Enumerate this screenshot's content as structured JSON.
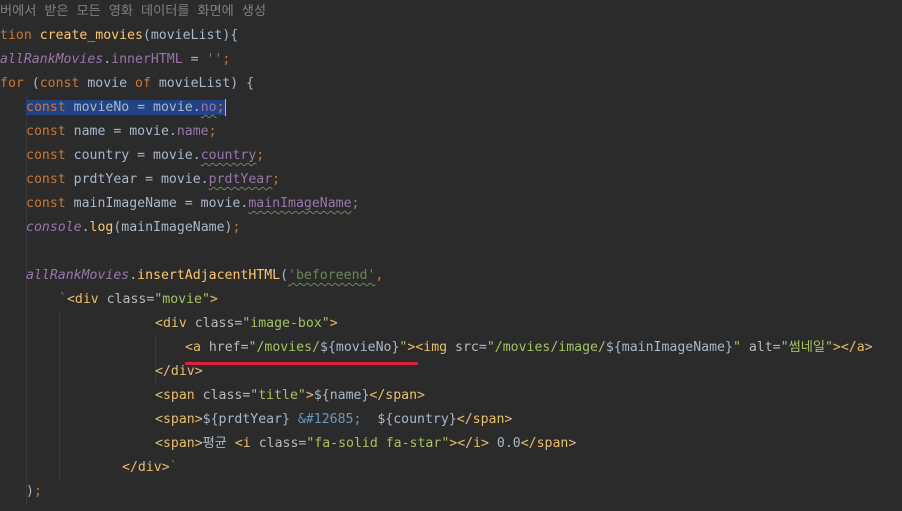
{
  "editor": {
    "lines": [
      {
        "indent": 0,
        "tokens": [
          {
            "t": "버에서 받은 모든 영화 데이터를 화면에 생성",
            "c": "c-comment"
          }
        ]
      },
      {
        "indent": 0,
        "tokens": [
          {
            "t": "tion ",
            "c": "c-kw"
          },
          {
            "t": "create_movies",
            "c": "c-fn"
          },
          {
            "t": "(movieList){",
            "c": "c-punc"
          }
        ]
      },
      {
        "indent": 0,
        "tokens": [
          {
            "t": "allRankMovies",
            "c": "c-global"
          },
          {
            "t": ".",
            "c": "c-punc"
          },
          {
            "t": "innerHTML",
            "c": "c-prop"
          },
          {
            "t": " = ",
            "c": "c-punc"
          },
          {
            "t": "''",
            "c": "c-str"
          },
          {
            "t": ";",
            "c": "c-kw"
          }
        ]
      },
      {
        "indent": 0,
        "tokens": [
          {
            "t": "for ",
            "c": "c-kw"
          },
          {
            "t": "(",
            "c": "c-punc"
          },
          {
            "t": "const ",
            "c": "c-kw"
          },
          {
            "t": "movie ",
            "c": "c-var"
          },
          {
            "t": "of ",
            "c": "c-kw"
          },
          {
            "t": "movieList) {",
            "c": "c-punc"
          }
        ]
      },
      {
        "indent": 1,
        "selected": true,
        "tokens": [
          {
            "t": "const ",
            "c": "c-kw"
          },
          {
            "t": "movieNo = movie.",
            "c": "c-var"
          },
          {
            "t": "no",
            "c": "c-prop squiggle"
          },
          {
            "t": ";",
            "c": "c-kw"
          }
        ]
      },
      {
        "indent": 1,
        "tokens": [
          {
            "t": "const ",
            "c": "c-kw"
          },
          {
            "t": "name = movie.",
            "c": "c-var"
          },
          {
            "t": "name",
            "c": "c-prop"
          },
          {
            "t": ";",
            "c": "c-kw"
          }
        ]
      },
      {
        "indent": 1,
        "tokens": [
          {
            "t": "const ",
            "c": "c-kw"
          },
          {
            "t": "country = movie.",
            "c": "c-var"
          },
          {
            "t": "country",
            "c": "c-prop squiggle"
          },
          {
            "t": ";",
            "c": "c-kw"
          }
        ]
      },
      {
        "indent": 1,
        "tokens": [
          {
            "t": "const ",
            "c": "c-kw"
          },
          {
            "t": "prdtYear = movie.",
            "c": "c-var"
          },
          {
            "t": "prdtYear",
            "c": "c-prop squiggle"
          },
          {
            "t": ";",
            "c": "c-kw"
          }
        ]
      },
      {
        "indent": 1,
        "tokens": [
          {
            "t": "const ",
            "c": "c-kw"
          },
          {
            "t": "mainImageName = movie.",
            "c": "c-var"
          },
          {
            "t": "mainImageName",
            "c": "c-prop squiggle"
          },
          {
            "t": ";",
            "c": "c-kw"
          }
        ]
      },
      {
        "indent": 1,
        "tokens": [
          {
            "t": "console",
            "c": "c-console"
          },
          {
            "t": ".",
            "c": "c-punc"
          },
          {
            "t": "log",
            "c": "c-method"
          },
          {
            "t": "(mainImageName)",
            "c": "c-punc"
          },
          {
            "t": ";",
            "c": "c-kw"
          }
        ]
      },
      {
        "indent": 0,
        "tokens": []
      },
      {
        "indent": 1,
        "tokens": [
          {
            "t": "allRankMovies",
            "c": "c-global"
          },
          {
            "t": ".",
            "c": "c-punc"
          },
          {
            "t": "insertAdjacentHTML",
            "c": "c-method"
          },
          {
            "t": "(",
            "c": "c-punc"
          },
          {
            "t": "'beforeend'",
            "c": "c-str squiggle"
          },
          {
            "t": ",",
            "c": "c-kw"
          }
        ]
      },
      {
        "indent": 2,
        "tokens": [
          {
            "t": "`",
            "c": "c-str"
          },
          {
            "t": "<div ",
            "c": "c-tag"
          },
          {
            "t": "class",
            "c": "c-attr"
          },
          {
            "t": "=",
            "c": "c-punc"
          },
          {
            "t": "\"movie\"",
            "c": "c-attrval"
          },
          {
            "t": ">",
            "c": "c-tag"
          }
        ]
      },
      {
        "indent": 3,
        "tokens": [
          {
            "t": "<div ",
            "c": "c-tag"
          },
          {
            "t": "class",
            "c": "c-attr"
          },
          {
            "t": "=",
            "c": "c-punc"
          },
          {
            "t": "\"image-box\"",
            "c": "c-attrval"
          },
          {
            "t": ">",
            "c": "c-tag"
          }
        ]
      },
      {
        "indent": 4,
        "tokens": [
          {
            "t": "<a ",
            "c": "c-tag"
          },
          {
            "t": "href",
            "c": "c-attr"
          },
          {
            "t": "=",
            "c": "c-punc"
          },
          {
            "t": "\"/movies/",
            "c": "c-attrval"
          },
          {
            "t": "${movieNo}",
            "c": "c-tmpl"
          },
          {
            "t": "\"",
            "c": "c-attrval"
          },
          {
            "t": ">",
            "c": "c-tag"
          },
          {
            "t": "<img ",
            "c": "c-tag"
          },
          {
            "t": "src",
            "c": "c-attr"
          },
          {
            "t": "=",
            "c": "c-punc"
          },
          {
            "t": "\"/movies/image/",
            "c": "c-attrval"
          },
          {
            "t": "${mainImageName}",
            "c": "c-tmpl"
          },
          {
            "t": "\" ",
            "c": "c-attrval"
          },
          {
            "t": "alt",
            "c": "c-attr"
          },
          {
            "t": "=",
            "c": "c-punc"
          },
          {
            "t": "\"썸네일\"",
            "c": "c-attrval"
          },
          {
            "t": "></a>",
            "c": "c-tag"
          }
        ]
      },
      {
        "indent": 3,
        "tokens": [
          {
            "t": "</div>",
            "c": "c-tag"
          }
        ]
      },
      {
        "indent": 3,
        "tokens": [
          {
            "t": "<span ",
            "c": "c-tag"
          },
          {
            "t": "class",
            "c": "c-attr"
          },
          {
            "t": "=",
            "c": "c-punc"
          },
          {
            "t": "\"title\"",
            "c": "c-attrval"
          },
          {
            "t": ">",
            "c": "c-tag"
          },
          {
            "t": "${name}",
            "c": "c-tmpl"
          },
          {
            "t": "</span>",
            "c": "c-tag"
          }
        ]
      },
      {
        "indent": 3,
        "tokens": [
          {
            "t": "<span>",
            "c": "c-tag"
          },
          {
            "t": "${prdtYear} ",
            "c": "c-tmpl"
          },
          {
            "t": "&#12685;",
            "c": "c-entity"
          },
          {
            "t": "  ",
            "c": "c-plain"
          },
          {
            "t": "${country}",
            "c": "c-tmpl"
          },
          {
            "t": "</span>",
            "c": "c-tag"
          }
        ]
      },
      {
        "indent": 3,
        "tokens": [
          {
            "t": "<span>",
            "c": "c-tag"
          },
          {
            "t": "평균 ",
            "c": "c-kor"
          },
          {
            "t": "<i ",
            "c": "c-tag"
          },
          {
            "t": "class",
            "c": "c-attr"
          },
          {
            "t": "=",
            "c": "c-punc"
          },
          {
            "t": "\"fa-solid fa-star\"",
            "c": "c-attrval"
          },
          {
            "t": "></i>",
            "c": "c-tag"
          },
          {
            "t": " 0.0",
            "c": "c-plain"
          },
          {
            "t": "</span>",
            "c": "c-tag"
          }
        ]
      },
      {
        "indent": 2.5,
        "tokens": [
          {
            "t": "</div>",
            "c": "c-tag"
          },
          {
            "t": "`",
            "c": "c-str"
          }
        ]
      },
      {
        "indent": 1,
        "tokens": [
          {
            "t": ")",
            "c": "c-punc"
          },
          {
            "t": ";",
            "c": "c-kw"
          }
        ]
      }
    ]
  }
}
